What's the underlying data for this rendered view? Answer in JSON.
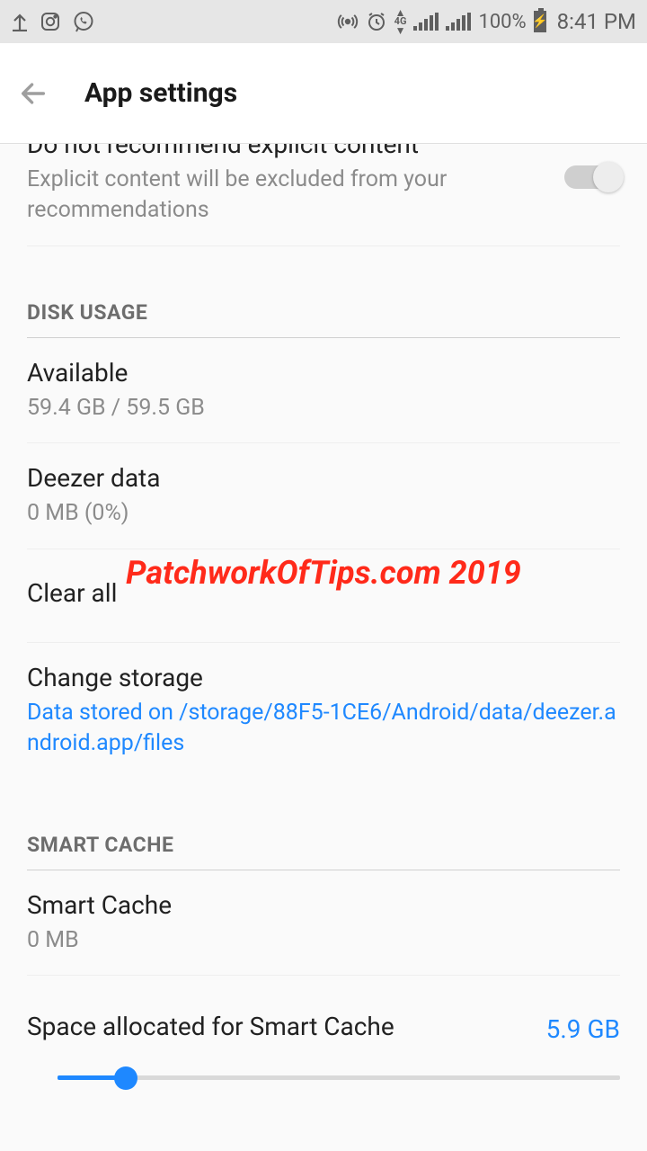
{
  "status": {
    "network_label": "4G",
    "battery_pct": "100%",
    "time": "8:41 PM"
  },
  "header": {
    "title": "App settings"
  },
  "explicit": {
    "title": "Do not recommend explicit content",
    "subtitle": "Explicit content will be excluded from your recommendations",
    "enabled": false
  },
  "disk": {
    "header": "DISK USAGE",
    "available": {
      "title": "Available",
      "value": "59.4 GB / 59.5 GB"
    },
    "deezer_data": {
      "title": "Deezer data",
      "value": "0 MB (0%)"
    },
    "clear_all": {
      "title": "Clear all"
    },
    "change_storage": {
      "title": "Change storage",
      "path": "Data stored on /storage/88F5-1CE6/Android/data/deezer.android.app/files"
    }
  },
  "smart_cache": {
    "header": "SMART CACHE",
    "usage": {
      "title": "Smart Cache",
      "value": "0 MB"
    },
    "allocated": {
      "title": "Space allocated for Smart Cache",
      "value": "5.9 GB"
    }
  },
  "watermark": "PatchworkOfTips.com 2019"
}
